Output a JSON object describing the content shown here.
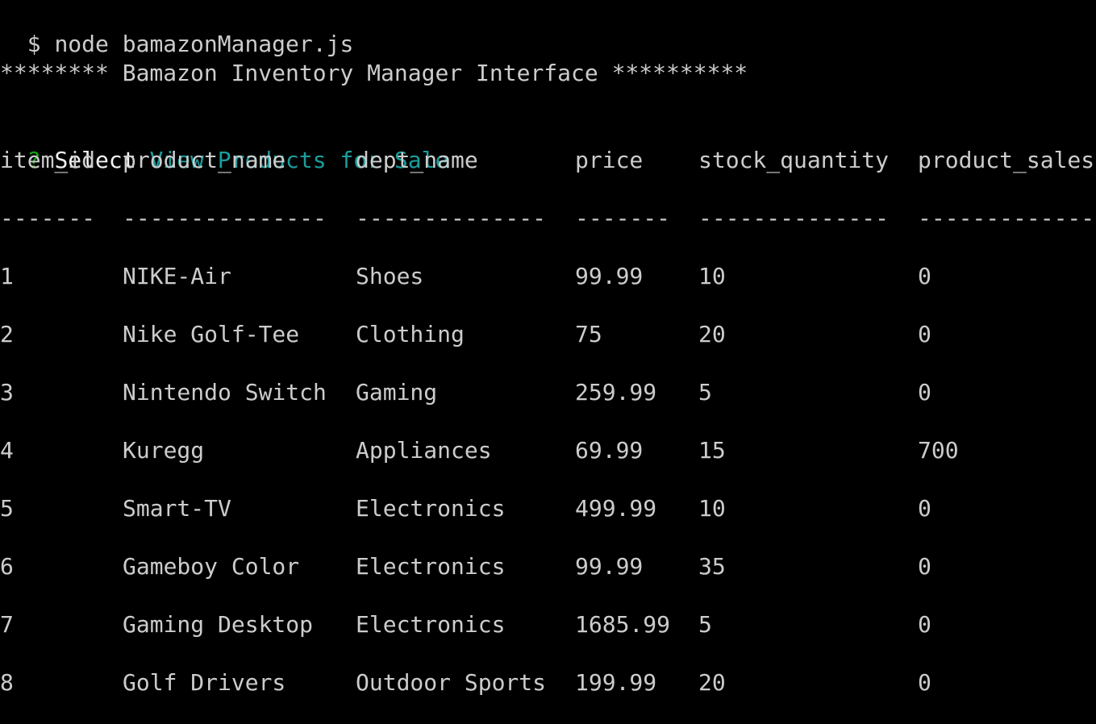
{
  "terminal": {
    "prompt_symbol": "$",
    "command": "node bamazonManager.js",
    "banner": "******** Bamazon Inventory Manager Interface **********",
    "question_mark": "?",
    "question_label": "Select",
    "selected_answer": "View Products for Sale",
    "colors": {
      "background": "#000000",
      "text": "#cccccc",
      "bright_text": "#f2f2f2",
      "question_mark": "#13a10e",
      "answer": "#1c9c9c"
    }
  },
  "table": {
    "headers": [
      "item_id",
      "product_name",
      "dept_name",
      "price",
      "stock_quantity",
      "product_sales"
    ],
    "separators": [
      "-------",
      "---------------",
      "--------------",
      "-------",
      "--------------",
      "--------------"
    ],
    "rows": [
      [
        "1",
        "NIKE-Air",
        "Shoes",
        "99.99",
        "10",
        "0"
      ],
      [
        "2",
        "Nike Golf-Tee",
        "Clothing",
        "75",
        "20",
        "0"
      ],
      [
        "3",
        "Nintendo Switch",
        "Gaming",
        "259.99",
        "5",
        "0"
      ],
      [
        "4",
        "Kuregg",
        "Appliances",
        "69.99",
        "15",
        "700"
      ],
      [
        "5",
        "Smart-TV",
        "Electronics",
        "499.99",
        "10",
        "0"
      ],
      [
        "6",
        "Gameboy Color",
        "Electronics",
        "99.99",
        "35",
        "0"
      ],
      [
        "7",
        "Gaming Desktop",
        "Electronics",
        "1685.99",
        "5",
        "0"
      ],
      [
        "8",
        "Golf Drivers",
        "Outdoor Sports",
        "199.99",
        "20",
        "0"
      ]
    ]
  }
}
